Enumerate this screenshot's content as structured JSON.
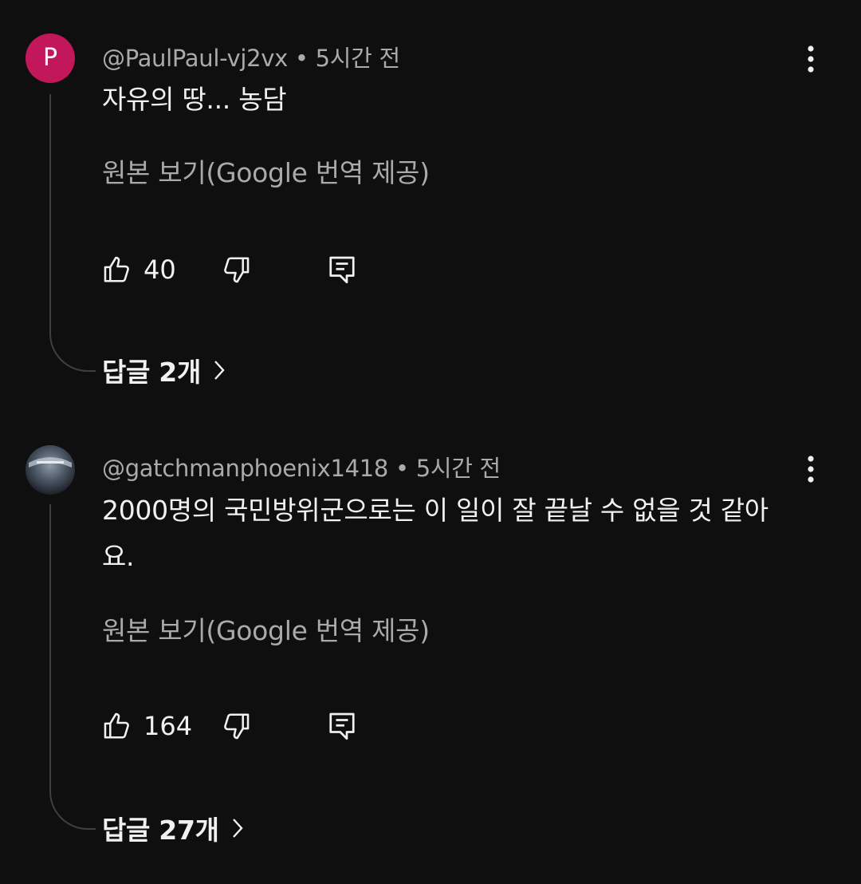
{
  "comments": [
    {
      "avatar_letter": "P",
      "avatar_color": "#c2185b",
      "author": "@PaulPaul-vj2vx",
      "separator": "•",
      "time": "5시간 전",
      "text": "자유의 땅... 농담",
      "translate_label": "원본 보기(Google 번역 제공)",
      "likes": "40",
      "replies_label": "답글 2개",
      "icons": [
        "thumb-up-icon",
        "thumb-down-icon",
        "reply-comment-icon",
        "more-vert-icon",
        "chevron-right-icon"
      ]
    },
    {
      "avatar_letter": "",
      "author": "@gatchmanphoenix1418",
      "separator": "•",
      "time": "5시간 전",
      "text": "2000명의 국민방위군으로는 이 일이 잘 끝날 수 없을 것 같아요.",
      "translate_label": "원본 보기(Google 번역 제공)",
      "likes": "164",
      "replies_label": "답글 27개",
      "icons": [
        "thumb-up-icon",
        "thumb-down-icon",
        "reply-comment-icon",
        "more-vert-icon",
        "chevron-right-icon"
      ]
    }
  ],
  "colors": {
    "background": "#0f0f0f",
    "primary_text": "#f1f1f1",
    "secondary_text": "#aaaaaa",
    "thread_line": "#3f3f3f"
  }
}
